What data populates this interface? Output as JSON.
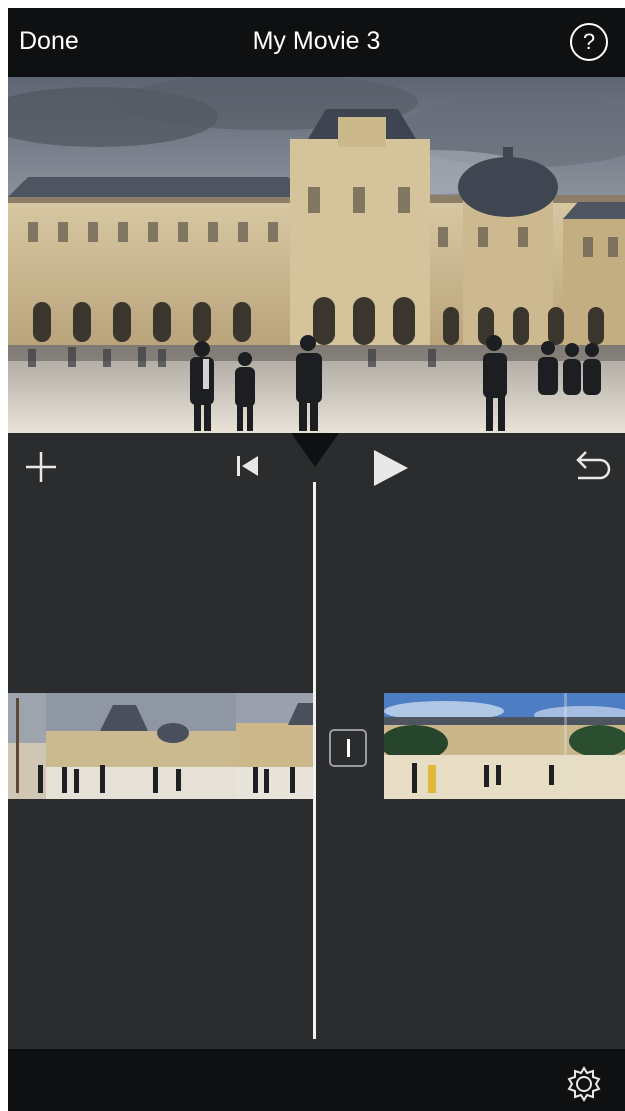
{
  "header": {
    "done_label": "Done",
    "title": "My Movie 3",
    "help_label": "?"
  },
  "preview": {
    "scene": "palace-courtyard-photo"
  },
  "toolbar": {
    "icons": [
      "add-icon",
      "skip-to-start-icon",
      "play-icon",
      "undo-icon"
    ]
  },
  "timeline": {
    "clips": [
      {
        "scene": "palace-courtyard-clip"
      },
      {
        "scene": "garden-palace-clip"
      }
    ],
    "transition_icon": "transition-icon"
  },
  "footer": {
    "icons": [
      "settings-gear-icon"
    ]
  },
  "colors": {
    "nav_background": "#0f1011",
    "panel_background": "#2b2c2e",
    "foreground": "#ffffff"
  }
}
